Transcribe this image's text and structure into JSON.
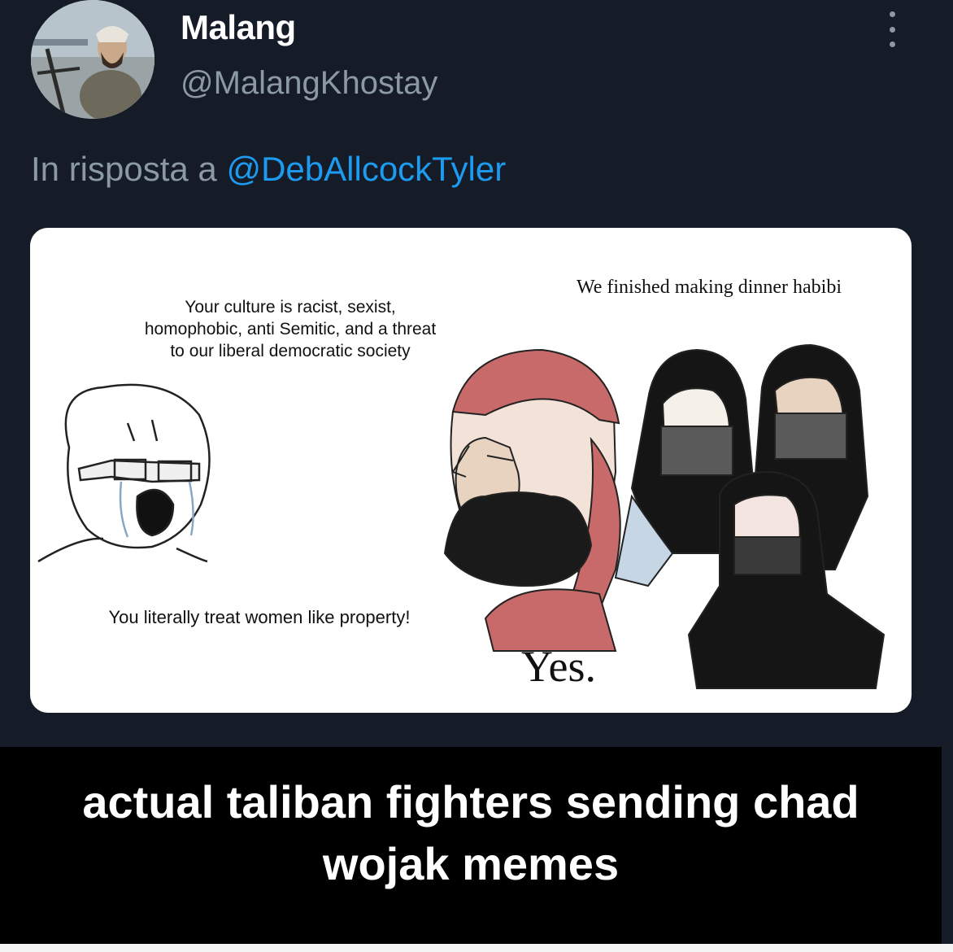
{
  "tweet": {
    "display_name": "Malang",
    "handle": "@MalangKhostay",
    "reply_prefix": "In risposta a",
    "reply_mention": "@DebAllcockTyler",
    "avatar_icon": "profile-photo",
    "more_icon": "vertical-ellipsis-icon"
  },
  "meme": {
    "soy_speech": "Your culture is racist, sexist, homophobic, anti Semitic, and a threat to our liberal democratic society",
    "soy_speech_2": "You literally treat women like property!",
    "women_speech": "We finished making dinner habibi",
    "chad_reply": "Yes."
  },
  "caption": "actual taliban fighters sending chad wojak memes",
  "colors": {
    "background": "#151b27",
    "name": "#ffffff",
    "handle": "#8b98a5",
    "mention": "#1d9bf0",
    "caption_bar": "#000000"
  }
}
